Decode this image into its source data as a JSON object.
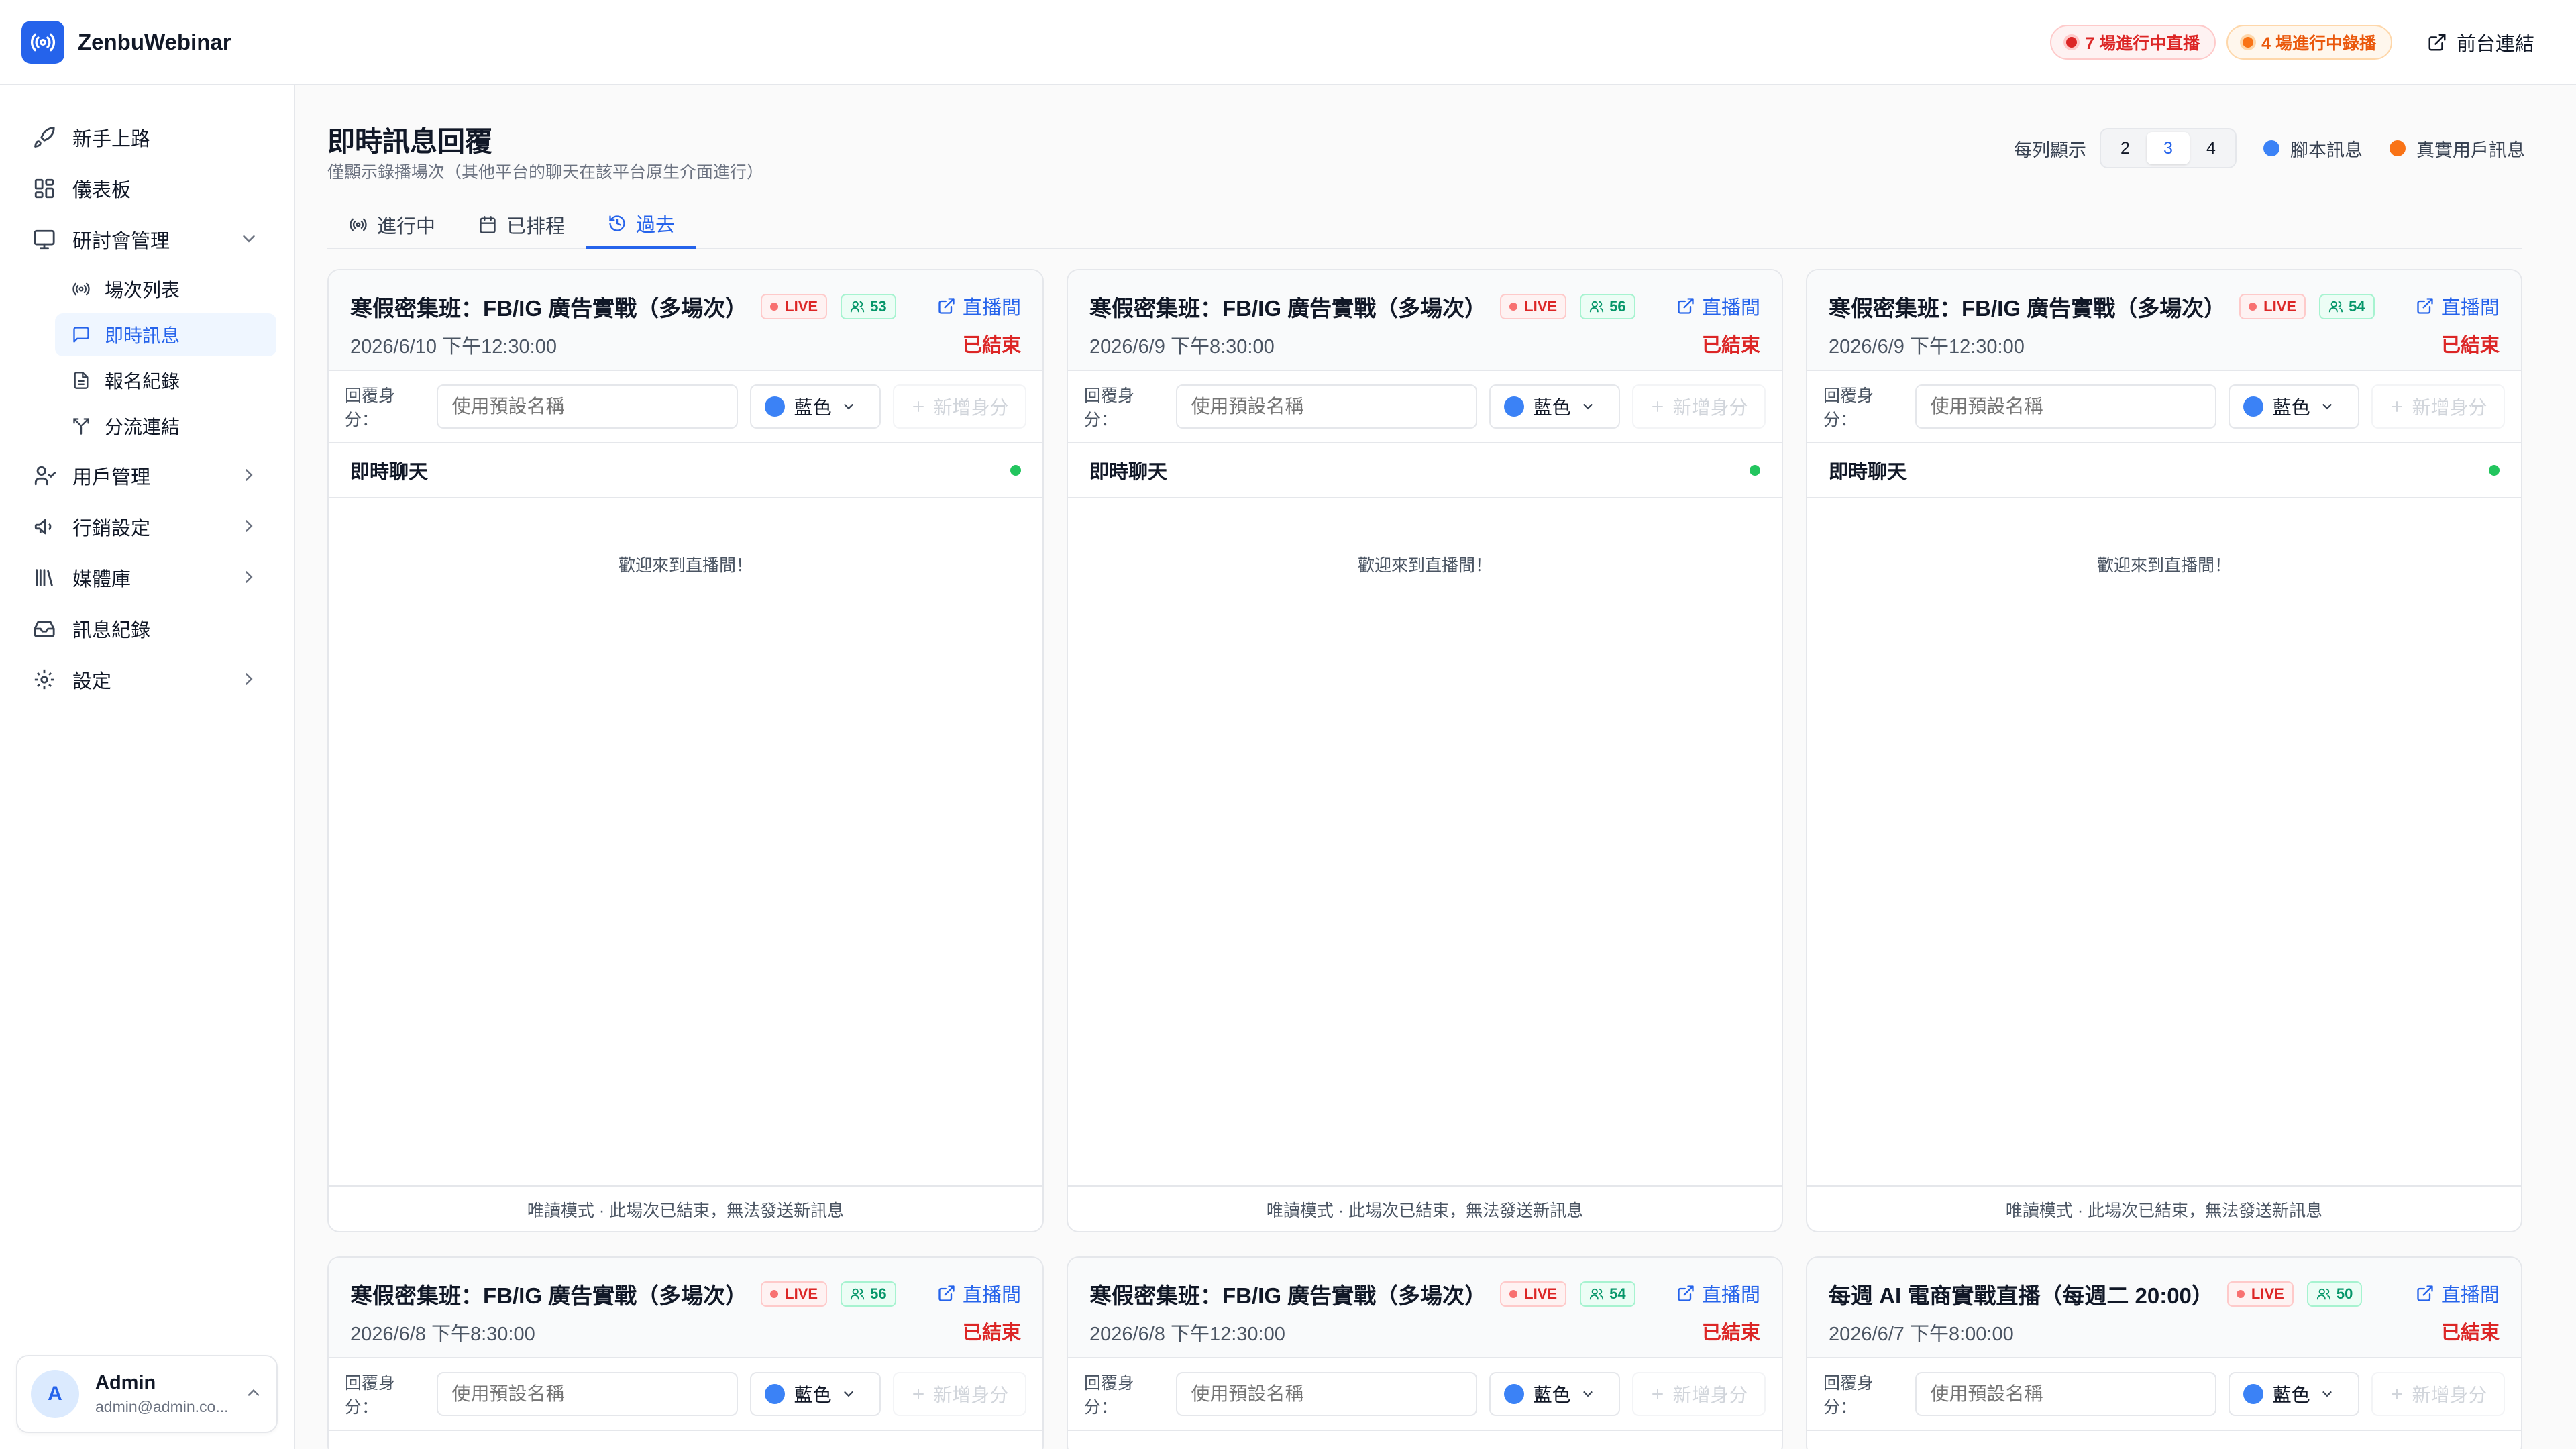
{
  "app": {
    "brand": "ZenbuWebinar"
  },
  "topbar": {
    "live_pill": "7 場進行中直播",
    "rec_pill": "4 場進行中錄播",
    "front_link": "前台連結"
  },
  "sidebar": {
    "items": [
      {
        "label": "新手上路",
        "icon": "rocket-icon"
      },
      {
        "label": "儀表板",
        "icon": "dashboard-icon"
      },
      {
        "label": "研討會管理",
        "icon": "presentation-icon"
      },
      {
        "label": "用戶管理",
        "icon": "users-icon"
      },
      {
        "label": "行銷設定",
        "icon": "megaphone-icon"
      },
      {
        "label": "媒體庫",
        "icon": "library-icon"
      },
      {
        "label": "訊息紀錄",
        "icon": "inbox-icon"
      },
      {
        "label": "設定",
        "icon": "gear-icon"
      }
    ],
    "sub_items": [
      {
        "label": "場次列表",
        "icon": "broadcast-icon"
      },
      {
        "label": "即時訊息",
        "icon": "chat-icon"
      },
      {
        "label": "報名紀錄",
        "icon": "file-icon"
      },
      {
        "label": "分流連結",
        "icon": "split-icon"
      }
    ],
    "user": {
      "initial": "A",
      "name": "Admin",
      "email": "admin@admin.co..."
    }
  },
  "main": {
    "title": "即時訊息回覆",
    "subtitle": "僅顯示錄播場次（其他平台的聊天在該平台原生介面進行）",
    "per_row_label": "每列顯示",
    "per_row_options": [
      "2",
      "3",
      "4"
    ],
    "per_row_selected": "3",
    "legend": [
      {
        "label": "腳本訊息",
        "color": "#3b82f6"
      },
      {
        "label": "真實用戶訊息",
        "color": "#f97316"
      }
    ],
    "tabs": [
      {
        "label": "進行中",
        "icon": "broadcast-icon"
      },
      {
        "label": "已排程",
        "icon": "calendar-icon"
      },
      {
        "label": "過去",
        "icon": "history-icon"
      }
    ],
    "active_tab": "過去"
  },
  "card_common": {
    "live_badge": "LIVE",
    "room_link": "直播間",
    "ended": "已結束",
    "reply_label": "回覆身分：",
    "reply_placeholder": "使用預設名稱",
    "color_label": "藍色",
    "add_identity": "新增身分",
    "chat_title": "即時聊天",
    "welcome": "歡迎來到直播間！",
    "readonly_note": "唯讀模式 · 此場次已結束，無法發送新訊息"
  },
  "cards": [
    {
      "title": "寒假密集班：FB/IG 廣告實戰（多場次）",
      "count": "53",
      "time": "2026/6/10 下午12:30:00"
    },
    {
      "title": "寒假密集班：FB/IG 廣告實戰（多場次）",
      "count": "56",
      "time": "2026/6/9 下午8:30:00"
    },
    {
      "title": "寒假密集班：FB/IG 廣告實戰（多場次）",
      "count": "54",
      "time": "2026/6/9 下午12:30:00"
    },
    {
      "title": "寒假密集班：FB/IG 廣告實戰（多場次）",
      "count": "56",
      "time": "2026/6/8 下午8:30:00"
    },
    {
      "title": "寒假密集班：FB/IG 廣告實戰（多場次）",
      "count": "54",
      "time": "2026/6/8 下午12:30:00"
    },
    {
      "title": "每週 AI 電商實戰直播（每週二 20:00）",
      "count": "50",
      "time": "2026/6/7 下午8:00:00"
    }
  ],
  "colors": {
    "accent": "#2563eb",
    "live": "#dc2626",
    "recording": "#ea580c",
    "online": "#22c55e"
  }
}
